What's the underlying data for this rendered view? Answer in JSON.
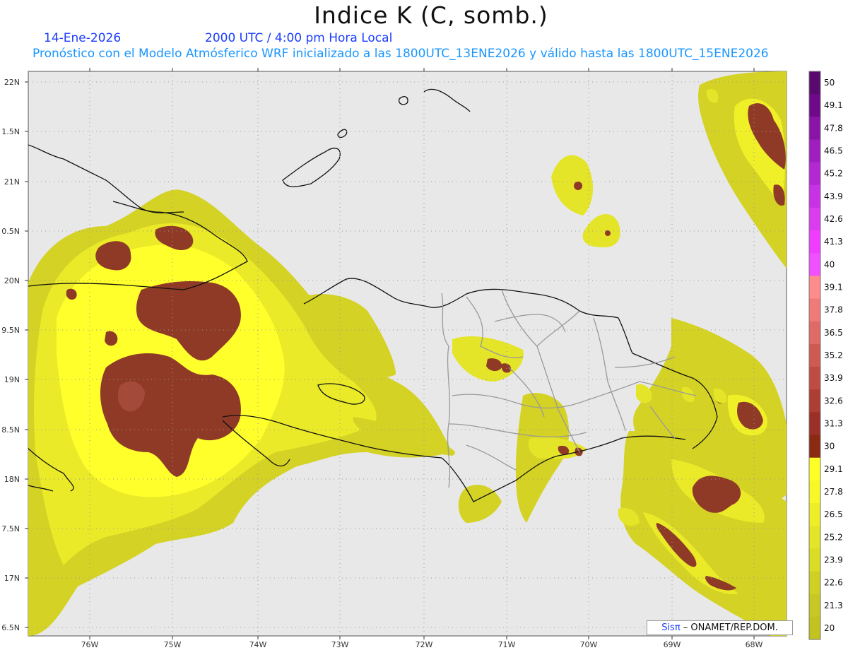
{
  "title": "Indice K (C, somb.)",
  "header": {
    "date": "14-Ene-2026",
    "time": "2000 UTC / 4:00 pm Hora Local",
    "description": "Pronóstico con el Modelo Atmósferico WRF inicializado a las 1800UTC_13ENE2026 y válido hasta las  1800UTC_15ENE2026"
  },
  "axes": {
    "lat_labels": [
      "22N",
      "1.5N",
      "21N",
      "0.5N",
      "20N",
      "9.5N",
      "19N",
      "8.5N",
      "18N",
      "7.5N",
      "17N",
      "6.5N"
    ],
    "lon_labels": [
      "76W",
      "75W",
      "74W",
      "73W",
      "72W",
      "71W",
      "70W",
      "69W",
      "68W"
    ]
  },
  "colorbar": {
    "labels": [
      "50",
      "49.1",
      "47.8",
      "46.5",
      "45.2",
      "43.9",
      "42.6",
      "41.3",
      "40",
      "39.1",
      "37.8",
      "36.5",
      "35.2",
      "33.9",
      "32.6",
      "31.3",
      "30",
      "29.1",
      "27.8",
      "26.5",
      "25.2",
      "23.9",
      "22.6",
      "21.3",
      "20"
    ],
    "colors": [
      "#5a0a6e",
      "#6e0a8a",
      "#8a14a6",
      "#a01ec0",
      "#b428d4",
      "#c832e6",
      "#dc3cf0",
      "#f03cff",
      "#f050ff",
      "#ff8c8c",
      "#f07a78",
      "#e06a66",
      "#cf5a54",
      "#be4c44",
      "#ac3e36",
      "#9a3028",
      "#8a2a10",
      "#ffff28",
      "#f8f828",
      "#eeee28",
      "#e4e428",
      "#dadc26",
      "#d0d024",
      "#c8c824",
      "#c2c220"
    ]
  },
  "credit": {
    "logo": "Sisπ",
    "text": " – ONAMET/REP.DOM."
  }
}
